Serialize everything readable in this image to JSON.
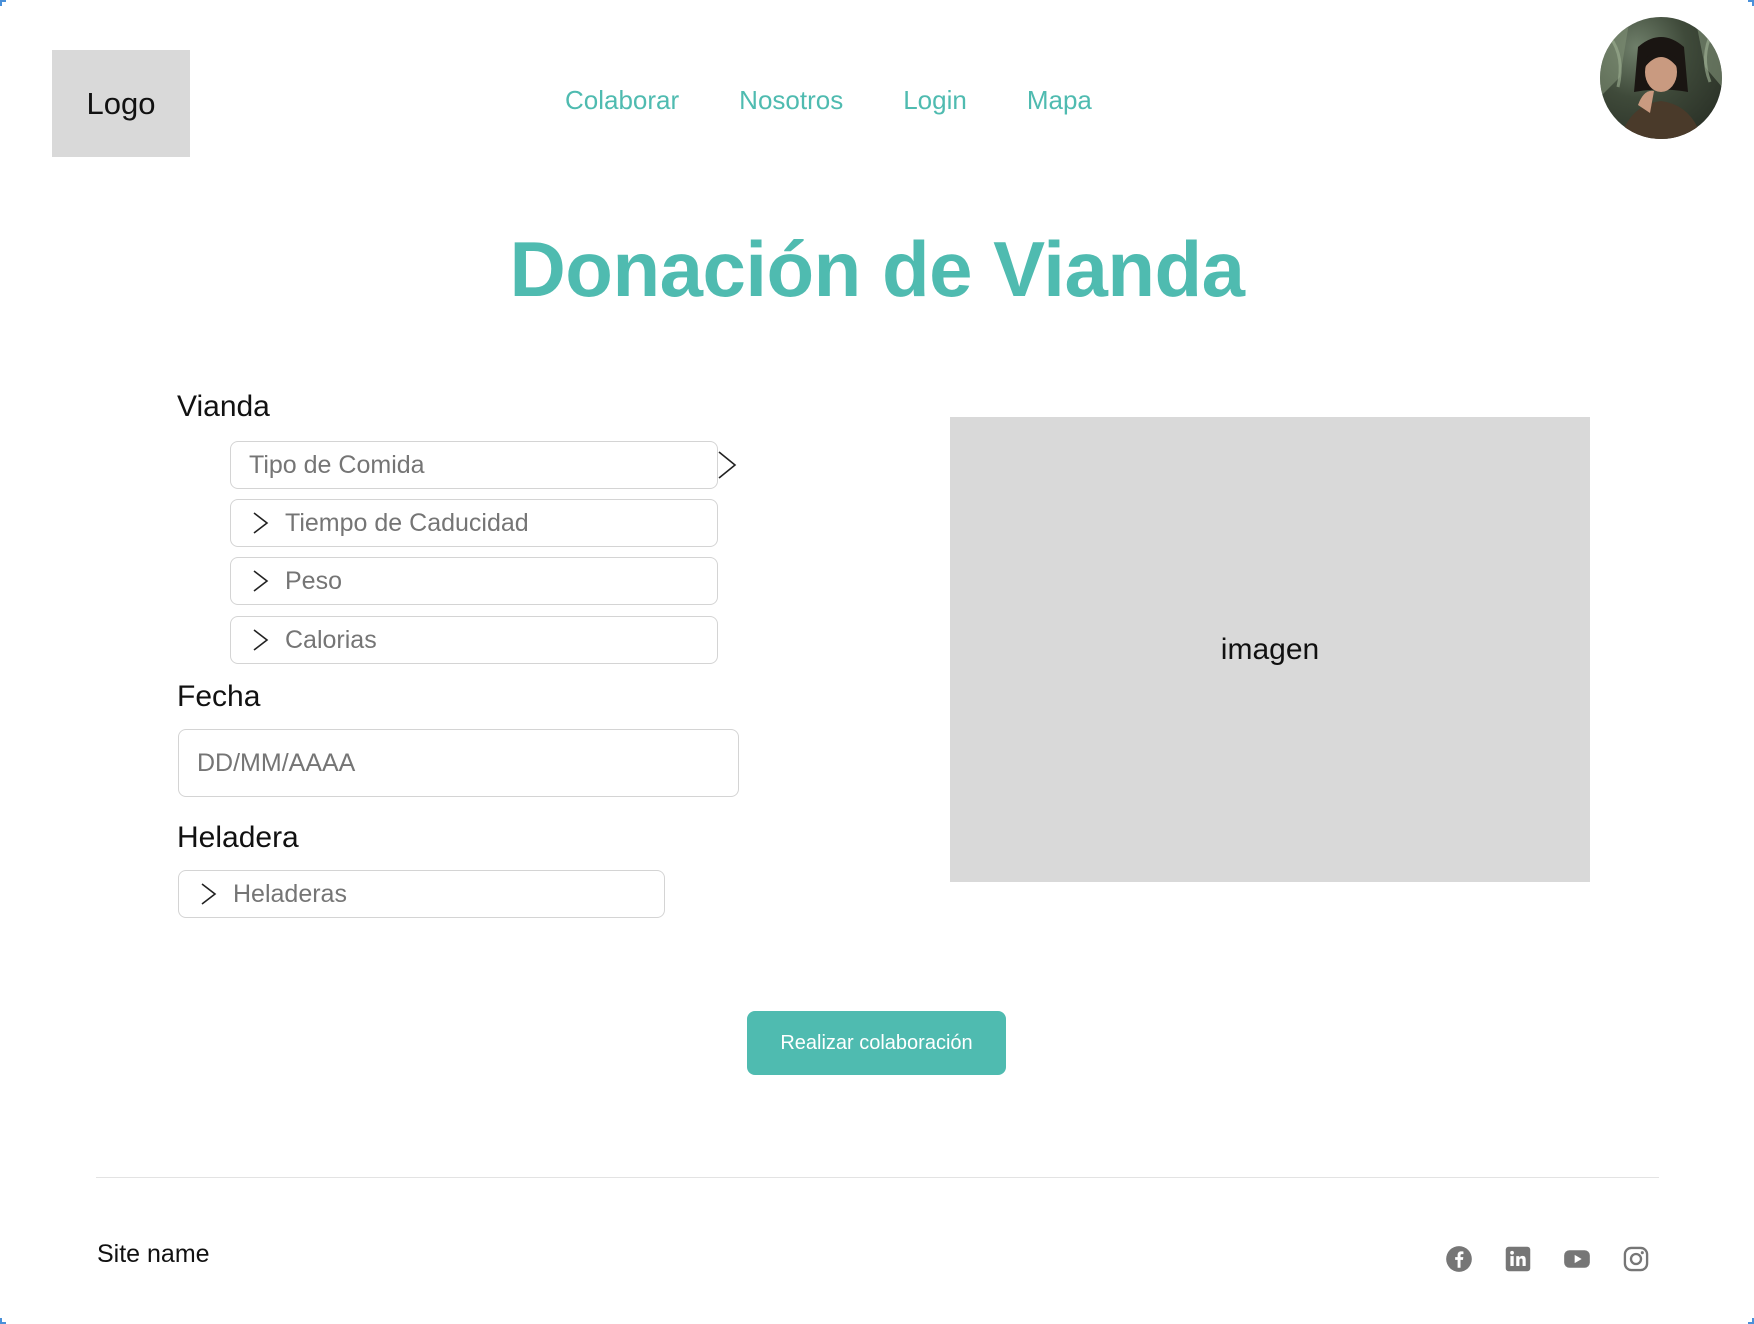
{
  "header": {
    "logo_text": "Logo",
    "nav": [
      "Colaborar",
      "Nosotros",
      "Login",
      "Mapa"
    ]
  },
  "page": {
    "title": "Donación de Vianda"
  },
  "form": {
    "vianda_label": "Vianda",
    "vianda_fields": [
      "Tipo de Comida",
      "Tiempo de Caducidad",
      "Peso",
      "Calorias"
    ],
    "fecha_label": "Fecha",
    "fecha_placeholder": "DD/MM/AAAA",
    "heladera_label": "Heladera",
    "heladera_field": "Heladeras",
    "submit_label": "Realizar colaboración"
  },
  "image_placeholder": "imagen",
  "footer": {
    "site_name": "Site name",
    "social_icons": [
      "facebook-icon",
      "linkedin-icon",
      "youtube-icon",
      "instagram-icon"
    ]
  },
  "colors": {
    "accent": "#4fbbb0",
    "placeholder_gray": "#d9d9d9",
    "field_text": "#757575",
    "icon_gray": "#767676"
  }
}
